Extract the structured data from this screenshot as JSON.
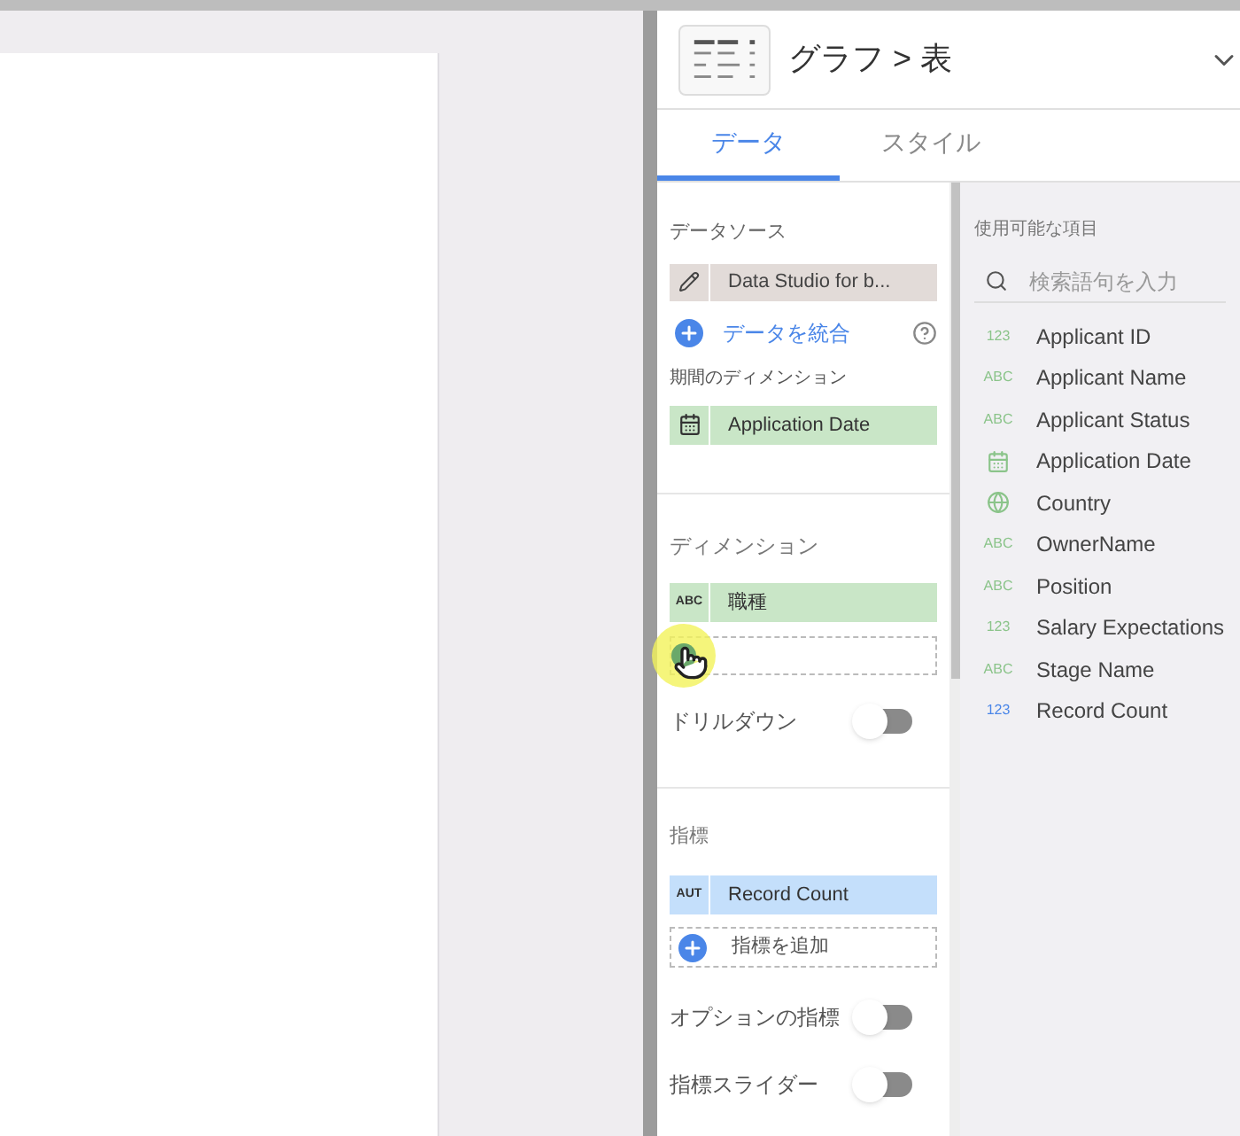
{
  "header": {
    "title": "グラフ > 表"
  },
  "tabs": [
    {
      "label": "データ",
      "selected": true
    },
    {
      "label": "スタイル",
      "selected": false
    }
  ],
  "data_source": {
    "heading": "データソース",
    "name": "Data Studio for b...",
    "blend_link": "データを統合"
  },
  "date_range_dimension": {
    "heading": "期間のディメンション",
    "field": "Application Date"
  },
  "dimensions": {
    "heading": "ディメンション",
    "chips": [
      {
        "type_label": "ABC",
        "name": "職種"
      }
    ],
    "drilldown": {
      "label": "ドリルダウン",
      "on": false
    }
  },
  "metrics": {
    "heading": "指標",
    "chips": [
      {
        "type_label": "AUT",
        "name": "Record Count"
      }
    ],
    "add_label": "指標を追加",
    "toggles": [
      {
        "label": "オプションの指標",
        "on": false
      },
      {
        "label": "指標スライダー",
        "on": false
      }
    ]
  },
  "available_fields": {
    "heading": "使用可能な項目",
    "search": {
      "placeholder": "検索語句を入力"
    },
    "items": [
      {
        "kind": "label",
        "type_label": "123",
        "name": "Applicant ID",
        "color": "#8bc48a"
      },
      {
        "kind": "label",
        "type_label": "ABC",
        "name": "Applicant Name",
        "color": "#8bc48a"
      },
      {
        "kind": "label",
        "type_label": "ABC",
        "name": "Applicant Status",
        "color": "#8bc48a"
      },
      {
        "kind": "date",
        "name": "Application Date",
        "color": "#8bc48a"
      },
      {
        "kind": "geo",
        "name": "Country",
        "color": "#8bc48a"
      },
      {
        "kind": "label",
        "type_label": "ABC",
        "name": "OwnerName",
        "color": "#8bc48a"
      },
      {
        "kind": "label",
        "type_label": "ABC",
        "name": "Position",
        "color": "#8bc48a"
      },
      {
        "kind": "label",
        "type_label": "123",
        "name": "Salary Expectations",
        "color": "#8bc48a"
      },
      {
        "kind": "label",
        "type_label": "ABC",
        "name": "Stage Name",
        "color": "#8bc48a"
      },
      {
        "kind": "label",
        "type_label": "123",
        "name": "Record Count",
        "color": "#4a86e8"
      }
    ]
  }
}
